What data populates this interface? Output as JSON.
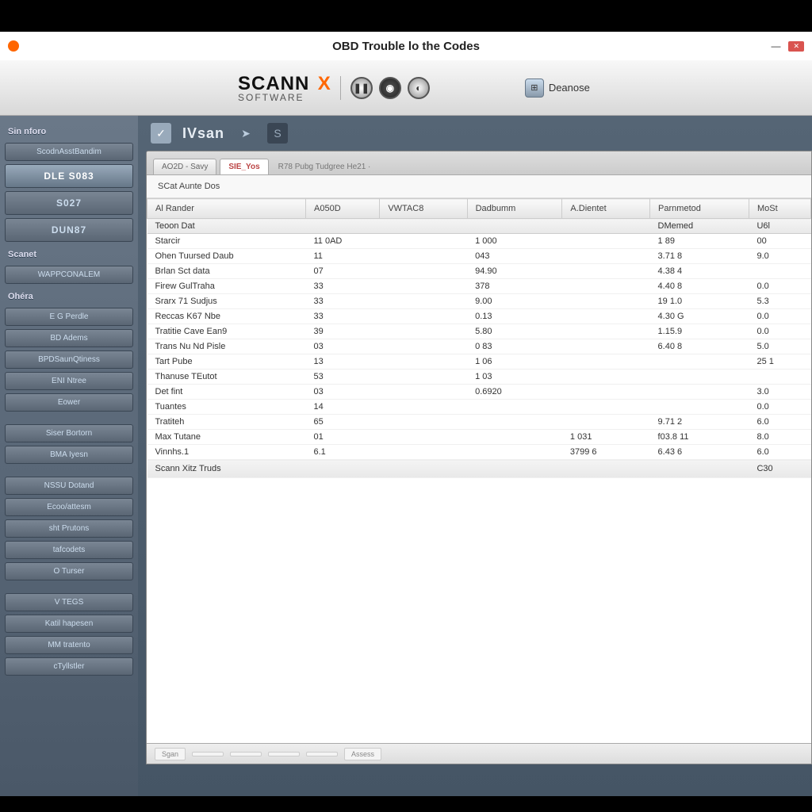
{
  "window": {
    "title": "OBD Trouble lo the Codes"
  },
  "ribbon": {
    "brand_main": "SCANN",
    "brand_sub": "SOFTWARE",
    "brand_x": "X",
    "diag_label": "Deanose"
  },
  "secondary": {
    "brand": "IVsan"
  },
  "sidebar": {
    "section1": "Sin nforo",
    "items1": [
      "ScodnAsstBandim",
      "DLE S083",
      "S027",
      "DUN87"
    ],
    "section2": "Scanet",
    "items2": [
      "WAPPCONALEM"
    ],
    "section3": "Ohéra",
    "items3": [
      "E G Perdle",
      "BD Adems",
      "BPDSaunQtiness",
      "ENI Ntree",
      "Eower"
    ],
    "items4": [
      "Siser Bortorn",
      "BMA Iyesn"
    ],
    "items5": [
      "NSSU Dotand",
      "Ecoo/attesm",
      "sht Prutons",
      "tafcodets",
      "O Turser"
    ],
    "items6": [
      "V TEGS",
      "Katil hapesen",
      "MM tratento",
      "cTyllstler"
    ]
  },
  "tabs": {
    "items": [
      "AO2D - Savy",
      "SIE_Yos"
    ],
    "trail": "R78 Pubg Tudgree He21 ·"
  },
  "subheader": "SCat Aunte Dos",
  "columns": [
    "Al Rander",
    "A050D",
    "VWTAC8",
    "Dadbumm",
    "A.Dientet",
    "Parnmetod",
    "MoSt"
  ],
  "rows": [
    [
      "Teoon Dat",
      "",
      "",
      "",
      "",
      "DMemed",
      "U6l"
    ],
    [
      "Starcir",
      "11 0AD",
      "",
      "1 000",
      "",
      "1 89",
      "00"
    ],
    [
      "Ohen Tuursed Daub",
      "11",
      "",
      "043",
      "",
      "3.71 8",
      "9.0"
    ],
    [
      "Brlan Sct data",
      "07",
      "",
      "94.90",
      "",
      "4.38 4",
      ""
    ],
    [
      "Firew GulTraha",
      "33",
      "",
      "378",
      "",
      "4.40 8",
      "0.0"
    ],
    [
      "Srarx 71 Sudjus",
      "33",
      "",
      "9.00",
      "",
      "19 1.0",
      "5.3"
    ],
    [
      "Reccas K67 Nbe",
      "33",
      "",
      "0.13",
      "",
      "4.30 G",
      "0.0"
    ],
    [
      "Tratitie Cave Ean9",
      "39",
      "",
      "5.80",
      "",
      "1.15.9",
      "0.0"
    ],
    [
      "Trans Nu Nd Pisle",
      "03",
      "",
      "0 83",
      "",
      "6.40 8",
      "5.0"
    ],
    [
      "Tart Pube",
      "13",
      "",
      "1 06",
      "",
      "",
      "25 1"
    ],
    [
      "Thanuse TEutot",
      "53",
      "",
      "1 03",
      "",
      "",
      ""
    ],
    [
      "Det fint",
      "03",
      "",
      "0.6920",
      "",
      "",
      "3.0"
    ],
    [
      "Tuantes",
      "14",
      "",
      "",
      "",
      "",
      "0.0"
    ],
    [
      "Tratiteh",
      "65",
      "",
      "",
      "",
      "9.71 2",
      "6.0"
    ],
    [
      "Max Tutane",
      "01",
      "",
      "",
      "1 031",
      "f03.8 11",
      "8.0"
    ],
    [
      "Vinnhs.1",
      "6.1",
      "",
      "",
      "3799 6",
      "6.43 6",
      "6.0"
    ],
    [
      "Scann Xitz Truds",
      "",
      "",
      "",
      "",
      "",
      "C30"
    ]
  ],
  "bottom": [
    "Sgan",
    "",
    "",
    "",
    "",
    "Assess"
  ]
}
